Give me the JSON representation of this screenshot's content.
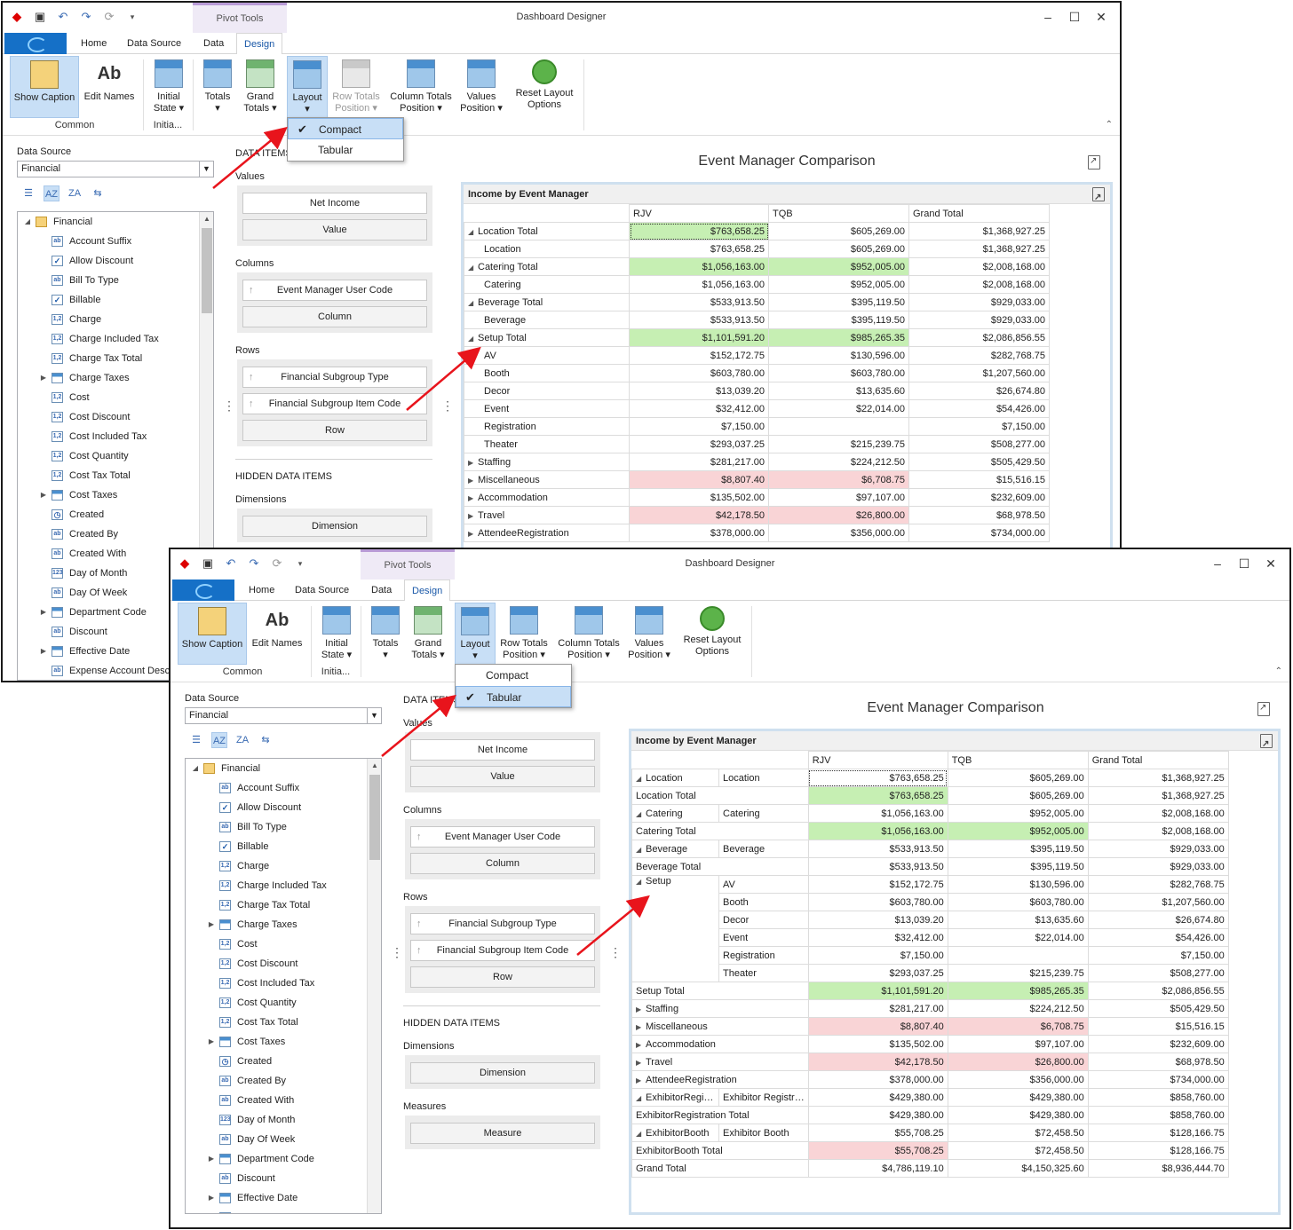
{
  "win1": {
    "title": "Dashboard Designer",
    "ctx": "Pivot Tools",
    "layout_opts": [
      {
        "label": "Compact",
        "checked": true
      },
      {
        "label": "Tabular",
        "checked": false
      }
    ],
    "pivot": {
      "rows": [
        {
          "c": [
            "Location Total",
            "$763,658.25",
            "$605,269.00",
            "$1,368,927.25"
          ],
          "t": 1,
          "ind": 0,
          "cls": [
            "g",
            "",
            ""
          ]
        },
        {
          "c": [
            "Location",
            "$763,658.25",
            "$605,269.00",
            "$1,368,927.25"
          ],
          "t": 0,
          "ind": 1,
          "cls": [
            "",
            "",
            ""
          ]
        },
        {
          "c": [
            "Catering Total",
            "$1,056,163.00",
            "$952,005.00",
            "$2,008,168.00"
          ],
          "t": 1,
          "ind": 0,
          "cls": [
            "g",
            "g",
            ""
          ]
        },
        {
          "c": [
            "Catering",
            "$1,056,163.00",
            "$952,005.00",
            "$2,008,168.00"
          ],
          "t": 0,
          "ind": 1,
          "cls": [
            "",
            "",
            ""
          ]
        },
        {
          "c": [
            "Beverage Total",
            "$533,913.50",
            "$395,119.50",
            "$929,033.00"
          ],
          "t": 1,
          "ind": 0,
          "cls": [
            "",
            "",
            ""
          ]
        },
        {
          "c": [
            "Beverage",
            "$533,913.50",
            "$395,119.50",
            "$929,033.00"
          ],
          "t": 0,
          "ind": 1,
          "cls": [
            "",
            "",
            ""
          ]
        },
        {
          "c": [
            "Setup Total",
            "$1,101,591.20",
            "$985,265.35",
            "$2,086,856.55"
          ],
          "t": 1,
          "ind": 0,
          "cls": [
            "g",
            "g",
            ""
          ]
        },
        {
          "c": [
            "AV",
            "$152,172.75",
            "$130,596.00",
            "$282,768.75"
          ],
          "t": 0,
          "ind": 1,
          "cls": [
            "",
            "",
            ""
          ]
        },
        {
          "c": [
            "Booth",
            "$603,780.00",
            "$603,780.00",
            "$1,207,560.00"
          ],
          "t": 0,
          "ind": 1,
          "cls": [
            "",
            "",
            ""
          ]
        },
        {
          "c": [
            "Decor",
            "$13,039.20",
            "$13,635.60",
            "$26,674.80"
          ],
          "t": 0,
          "ind": 1,
          "cls": [
            "",
            "",
            ""
          ]
        },
        {
          "c": [
            "Event",
            "$32,412.00",
            "$22,014.00",
            "$54,426.00"
          ],
          "t": 0,
          "ind": 1,
          "cls": [
            "",
            "",
            ""
          ]
        },
        {
          "c": [
            "Registration",
            "$7,150.00",
            "",
            "$7,150.00"
          ],
          "t": 0,
          "ind": 1,
          "cls": [
            "",
            "",
            ""
          ]
        },
        {
          "c": [
            "Theater",
            "$293,037.25",
            "$215,239.75",
            "$508,277.00"
          ],
          "t": 0,
          "ind": 1,
          "cls": [
            "",
            "",
            ""
          ]
        },
        {
          "c": [
            "Staffing",
            "$281,217.00",
            "$224,212.50",
            "$505,429.50"
          ],
          "t": 2,
          "ind": 0,
          "cls": [
            "",
            "",
            ""
          ]
        },
        {
          "c": [
            "Miscellaneous",
            "$8,807.40",
            "$6,708.75",
            "$15,516.15"
          ],
          "t": 2,
          "ind": 0,
          "cls": [
            "r",
            "r",
            ""
          ]
        },
        {
          "c": [
            "Accommodation",
            "$135,502.00",
            "$97,107.00",
            "$232,609.00"
          ],
          "t": 2,
          "ind": 0,
          "cls": [
            "",
            "",
            ""
          ]
        },
        {
          "c": [
            "Travel",
            "$42,178.50",
            "$26,800.00",
            "$68,978.50"
          ],
          "t": 2,
          "ind": 0,
          "cls": [
            "r",
            "r",
            ""
          ]
        },
        {
          "c": [
            "AttendeeRegistration",
            "$378,000.00",
            "$356,000.00",
            "$734,000.00"
          ],
          "t": 2,
          "ind": 0,
          "cls": [
            "",
            "",
            ""
          ]
        }
      ]
    }
  },
  "win2": {
    "title": "Dashboard Designer",
    "ctx": "Pivot Tools",
    "layout_opts": [
      {
        "label": "Compact",
        "checked": false
      },
      {
        "label": "Tabular",
        "checked": true
      }
    ],
    "measures_label": "Measures",
    "measure": "Measure",
    "pivot": {
      "rows": [
        {
          "a": "Location",
          "b": "Location",
          "v": [
            "$763,658.25",
            "$605,269.00",
            "$1,368,927.25"
          ],
          "cls": [
            "sel",
            "",
            ""
          ],
          "ta": 1
        },
        {
          "a": "Location Total",
          "b": null,
          "v": [
            "$763,658.25",
            "$605,269.00",
            "$1,368,927.25"
          ],
          "cls": [
            "g",
            "",
            ""
          ],
          "ta": 0
        },
        {
          "a": "Catering",
          "b": "Catering",
          "v": [
            "$1,056,163.00",
            "$952,005.00",
            "$2,008,168.00"
          ],
          "cls": [
            "",
            "",
            ""
          ],
          "ta": 1
        },
        {
          "a": "Catering Total",
          "b": null,
          "v": [
            "$1,056,163.00",
            "$952,005.00",
            "$2,008,168.00"
          ],
          "cls": [
            "g",
            "g",
            ""
          ],
          "ta": 0
        },
        {
          "a": "Beverage",
          "b": "Beverage",
          "v": [
            "$533,913.50",
            "$395,119.50",
            "$929,033.00"
          ],
          "cls": [
            "",
            "",
            ""
          ],
          "ta": 1
        },
        {
          "a": "Beverage Total",
          "b": null,
          "v": [
            "$533,913.50",
            "$395,119.50",
            "$929,033.00"
          ],
          "cls": [
            "",
            "",
            ""
          ],
          "ta": 0
        },
        {
          "a": "Setup",
          "b": "AV",
          "v": [
            "$152,172.75",
            "$130,596.00",
            "$282,768.75"
          ],
          "cls": [
            "",
            "",
            ""
          ],
          "ta": 1,
          "span": 6
        },
        {
          "a": null,
          "b": "Booth",
          "v": [
            "$603,780.00",
            "$603,780.00",
            "$1,207,560.00"
          ],
          "cls": [
            "",
            "",
            ""
          ]
        },
        {
          "a": null,
          "b": "Decor",
          "v": [
            "$13,039.20",
            "$13,635.60",
            "$26,674.80"
          ],
          "cls": [
            "",
            "",
            ""
          ]
        },
        {
          "a": null,
          "b": "Event",
          "v": [
            "$32,412.00",
            "$22,014.00",
            "$54,426.00"
          ],
          "cls": [
            "",
            "",
            ""
          ]
        },
        {
          "a": null,
          "b": "Registration",
          "v": [
            "$7,150.00",
            "",
            "$7,150.00"
          ],
          "cls": [
            "",
            "",
            ""
          ]
        },
        {
          "a": null,
          "b": "Theater",
          "v": [
            "$293,037.25",
            "$215,239.75",
            "$508,277.00"
          ],
          "cls": [
            "",
            "",
            ""
          ]
        },
        {
          "a": "Setup Total",
          "b": null,
          "v": [
            "$1,101,591.20",
            "$985,265.35",
            "$2,086,856.55"
          ],
          "cls": [
            "g",
            "g",
            ""
          ],
          "ta": 0
        },
        {
          "a": "Staffing",
          "b": null,
          "v": [
            "$281,217.00",
            "$224,212.50",
            "$505,429.50"
          ],
          "cls": [
            "",
            "",
            ""
          ],
          "ta": 2
        },
        {
          "a": "Miscellaneous",
          "b": null,
          "v": [
            "$8,807.40",
            "$6,708.75",
            "$15,516.15"
          ],
          "cls": [
            "r",
            "r",
            ""
          ],
          "ta": 2
        },
        {
          "a": "Accommodation",
          "b": null,
          "v": [
            "$135,502.00",
            "$97,107.00",
            "$232,609.00"
          ],
          "cls": [
            "",
            "",
            ""
          ],
          "ta": 2
        },
        {
          "a": "Travel",
          "b": null,
          "v": [
            "$42,178.50",
            "$26,800.00",
            "$68,978.50"
          ],
          "cls": [
            "r",
            "r",
            ""
          ],
          "ta": 2
        },
        {
          "a": "AttendeeRegistration",
          "b": null,
          "v": [
            "$378,000.00",
            "$356,000.00",
            "$734,000.00"
          ],
          "cls": [
            "",
            "",
            ""
          ],
          "ta": 2
        },
        {
          "a": "ExhibitorRegi…",
          "b": "Exhibitor Registr…",
          "v": [
            "$429,380.00",
            "$429,380.00",
            "$858,760.00"
          ],
          "cls": [
            "",
            "",
            ""
          ],
          "ta": 1
        },
        {
          "a": "ExhibitorRegistration Total",
          "b": null,
          "v": [
            "$429,380.00",
            "$429,380.00",
            "$858,760.00"
          ],
          "cls": [
            "",
            "",
            ""
          ],
          "ta": 0
        },
        {
          "a": "ExhibitorBooth",
          "b": "Exhibitor Booth",
          "v": [
            "$55,708.25",
            "$72,458.50",
            "$128,166.75"
          ],
          "cls": [
            "",
            "",
            ""
          ],
          "ta": 1
        },
        {
          "a": "ExhibitorBooth Total",
          "b": null,
          "v": [
            "$55,708.25",
            "$72,458.50",
            "$128,166.75"
          ],
          "cls": [
            "r",
            "",
            ""
          ],
          "ta": 0
        },
        {
          "a": "Grand Total",
          "b": null,
          "v": [
            "$4,786,119.10",
            "$4,150,325.60",
            "$8,936,444.70"
          ],
          "cls": [
            "",
            "",
            ""
          ],
          "ta": 0
        }
      ]
    }
  },
  "tabs": {
    "home": "Home",
    "datasource": "Data Source",
    "data": "Data",
    "design": "Design"
  },
  "ribbon": {
    "show_caption": "Show Caption",
    "edit_names": "Edit Names",
    "initial": "Initial",
    "state": "State",
    "totals": "Totals",
    "grand": "Grand",
    "grand_totals": "Totals",
    "layout": "Layout",
    "row_totals": "Row Totals",
    "position": "Position",
    "col_totals": "Column Totals",
    "values": "Values",
    "reset": "Reset Layout",
    "options": "Options",
    "grp_common": "Common",
    "grp_initia": "Initia..."
  },
  "panel": {
    "ds_label": "Data Source",
    "ds_value": "Financial",
    "data_items": "DATA ITEMS",
    "values": "Values",
    "net_income": "Net Income",
    "value_ph": "Value",
    "columns": "Columns",
    "emuc": "Event Manager User Code",
    "column_ph": "Column",
    "rows": "Rows",
    "fsgt": "Financial Subgroup Type",
    "fsgic": "Financial Subgroup Item Code",
    "row_ph": "Row",
    "hidden": "HIDDEN DATA ITEMS",
    "dimensions": "Dimensions",
    "dimension": "Dimension"
  },
  "tree": {
    "root": "Financial",
    "items": [
      {
        "l": "Account Suffix",
        "i": "ab"
      },
      {
        "l": "Allow Discount",
        "i": "chk"
      },
      {
        "l": "Bill To Type",
        "i": "ab"
      },
      {
        "l": "Billable",
        "i": "chk"
      },
      {
        "l": "Charge",
        "i": "12"
      },
      {
        "l": "Charge Included Tax",
        "i": "12"
      },
      {
        "l": "Charge Tax Total",
        "i": "12"
      },
      {
        "l": "Charge Taxes",
        "i": "tbl",
        "e": 1
      },
      {
        "l": "Cost",
        "i": "12"
      },
      {
        "l": "Cost Discount",
        "i": "12"
      },
      {
        "l": "Cost Included Tax",
        "i": "12"
      },
      {
        "l": "Cost Quantity",
        "i": "12"
      },
      {
        "l": "Cost Tax Total",
        "i": "12"
      },
      {
        "l": "Cost Taxes",
        "i": "tbl",
        "e": 1
      },
      {
        "l": "Created",
        "i": "clk"
      },
      {
        "l": "Created By",
        "i": "ab"
      },
      {
        "l": "Created With",
        "i": "ab"
      },
      {
        "l": "Day of Month",
        "i": "123"
      },
      {
        "l": "Day Of Week",
        "i": "ab"
      },
      {
        "l": "Department Code",
        "i": "tbl",
        "e": 1
      },
      {
        "l": "Discount",
        "i": "ab"
      },
      {
        "l": "Effective Date",
        "i": "tbl",
        "e": 1
      },
      {
        "l": "Expense Account Description",
        "i": "ab"
      }
    ]
  },
  "dashboard": {
    "title": "Event Manager Comparison",
    "pivot_title": "Income by Event Manager",
    "cols": [
      "RJV",
      "TQB",
      "Grand Total"
    ]
  }
}
